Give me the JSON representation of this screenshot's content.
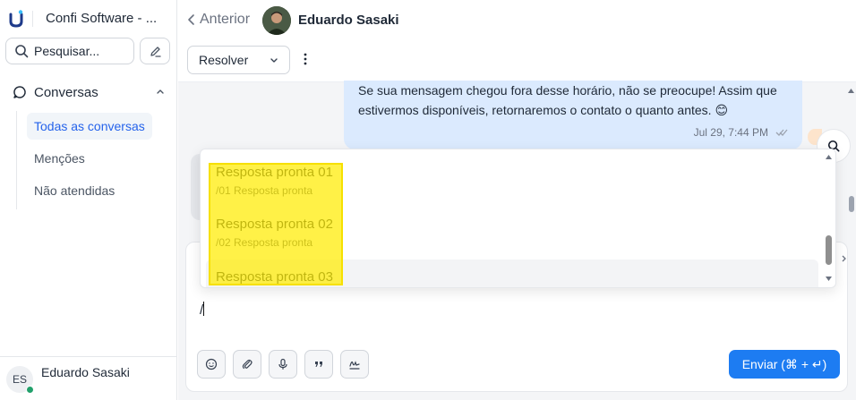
{
  "sidebar": {
    "brand_name": "Confi Software - ...",
    "search_placeholder": "Pesquisar...",
    "section_label": "Conversas",
    "items": [
      {
        "label": "Todas as conversas",
        "active": true
      },
      {
        "label": "Menções",
        "active": false
      },
      {
        "label": "Não atendidas",
        "active": false
      }
    ],
    "user": {
      "initials": "ES",
      "name": "Eduardo Sasaki",
      "status_color": "#22a06b"
    }
  },
  "header": {
    "back_label": "Anterior",
    "contact_name": "Eduardo Sasaki",
    "resolve_label": "Resolver"
  },
  "messages": [
    {
      "direction": "outgoing",
      "text": "Se sua mensagem chegou fora desse horário, não se preocupe! Assim que estivermos disponíveis, retornaremos o contato o quanto antes. 😊",
      "time": "Jul 29, 7:44 PM"
    }
  ],
  "canned_responses": [
    {
      "title": "Resposta pronta 01",
      "shortcut": "/01 Resposta pronta"
    },
    {
      "title": "Resposta pronta 02",
      "shortcut": "/02 Resposta pronta"
    },
    {
      "title": "Resposta pronta 03",
      "shortcut": ""
    }
  ],
  "composer": {
    "text": "/",
    "send_label": "Enviar (⌘ + ↵)"
  },
  "colors": {
    "accent": "#1d7cf2",
    "active_nav": "#2563eb",
    "outgoing_bubble": "#dbeafe",
    "highlight": "#ffec00"
  }
}
